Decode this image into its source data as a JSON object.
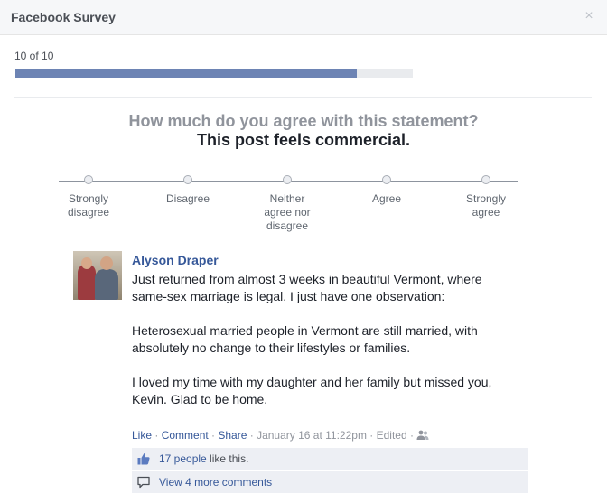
{
  "dialog": {
    "title": "Facebook Survey",
    "close_label": "×"
  },
  "progress": {
    "text": "10 of 10",
    "current": 10,
    "total": 10,
    "fill_fraction": 0.86
  },
  "survey": {
    "question": "How much do you agree with this statement?",
    "statement": "This post feels commercial.",
    "options": [
      {
        "label": "Strongly disagree"
      },
      {
        "label": "Disagree"
      },
      {
        "label": "Neither agree nor disagree"
      },
      {
        "label": "Agree"
      },
      {
        "label": "Strongly agree"
      }
    ]
  },
  "post": {
    "author": "Alyson Draper",
    "paragraphs": [
      "Just returned from almost 3 weeks in beautiful Vermont, where same-sex marriage is legal. I just have one observation:",
      "Heterosexual married people in Vermont are still married, with absolutely no change to their lifestyles or families.",
      "I loved my time with my daughter and her family but missed you, Kevin. Glad to be home."
    ],
    "actions": {
      "like": "Like",
      "comment": "Comment",
      "share": "Share",
      "separator": " · ",
      "timestamp": "January 16 at 11:22pm",
      "edited": "Edited"
    },
    "likes": {
      "link": "17 people",
      "suffix": " like this."
    },
    "comments": {
      "link": "View 4 more comments"
    }
  },
  "colors": {
    "link": "#365899",
    "progress_fill": "#6d84b4",
    "ufi_background": "#edeff4"
  }
}
